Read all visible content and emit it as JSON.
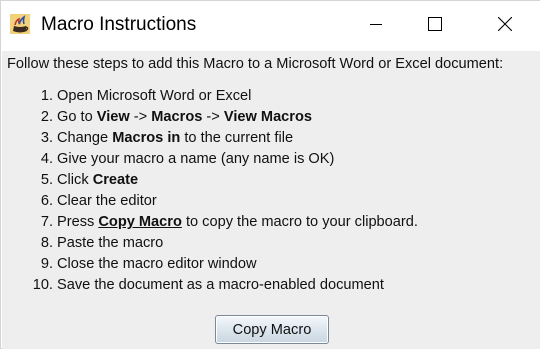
{
  "window": {
    "title": "Macro Instructions",
    "controls": [
      "minimize",
      "maximize",
      "close"
    ]
  },
  "instructions": {
    "intro": "Follow these steps to add this Macro to a Microsoft Word or Excel document:",
    "steps": [
      {
        "n": "1.",
        "parts": [
          {
            "t": "Open Microsoft Word or Excel",
            "b": false
          }
        ]
      },
      {
        "n": "2.",
        "parts": [
          {
            "t": "Go to ",
            "b": false
          },
          {
            "t": "View",
            "b": true
          },
          {
            "t": " -> ",
            "b": false
          },
          {
            "t": "Macros",
            "b": true
          },
          {
            "t": " -> ",
            "b": false
          },
          {
            "t": "View Macros",
            "b": true
          }
        ]
      },
      {
        "n": "3.",
        "parts": [
          {
            "t": "Change ",
            "b": false
          },
          {
            "t": "Macros in",
            "b": true
          },
          {
            "t": " to the current file",
            "b": false
          }
        ]
      },
      {
        "n": "4.",
        "parts": [
          {
            "t": "Give your macro a name (any name is OK)",
            "b": false
          }
        ]
      },
      {
        "n": "5.",
        "parts": [
          {
            "t": "Click ",
            "b": false
          },
          {
            "t": "Create",
            "b": true
          }
        ]
      },
      {
        "n": "6.",
        "parts": [
          {
            "t": "Clear the editor",
            "b": false
          }
        ]
      },
      {
        "n": "7.",
        "parts": [
          {
            "t": "Press ",
            "b": false
          },
          {
            "t": "Copy Macro",
            "b": true,
            "u": true
          },
          {
            "t": " to copy the macro to your clipboard.",
            "b": false
          }
        ]
      },
      {
        "n": "8.",
        "parts": [
          {
            "t": "Paste the macro",
            "b": false
          }
        ]
      },
      {
        "n": "9.",
        "parts": [
          {
            "t": "Close the macro editor window",
            "b": false
          }
        ]
      },
      {
        "n": "10.",
        "parts": [
          {
            "t": "Save the document as a macro-enabled document",
            "b": false
          }
        ]
      }
    ]
  },
  "buttons": {
    "copy_macro": "Copy Macro"
  },
  "icons": {
    "app": "java-coffee-cup-icon",
    "minimize": "minimize-icon",
    "maximize": "maximize-icon",
    "close": "close-icon"
  }
}
